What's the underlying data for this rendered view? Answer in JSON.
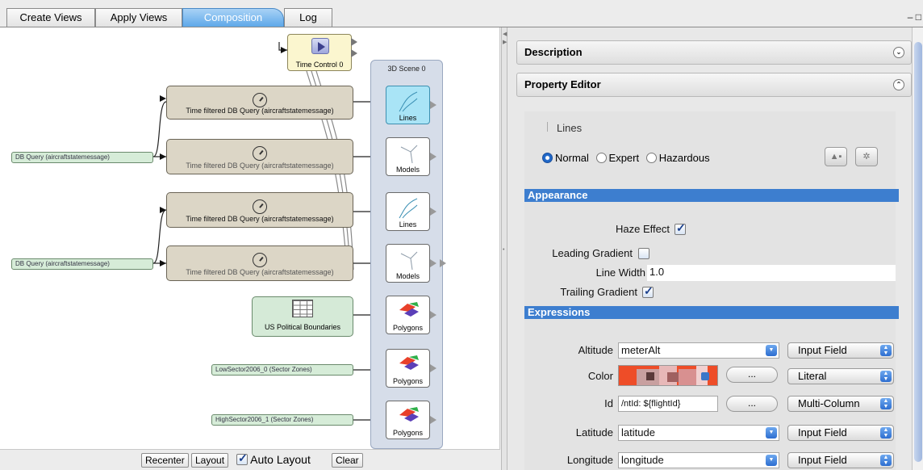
{
  "tabs": [
    {
      "label": "Create Views",
      "active": false
    },
    {
      "label": "Apply Views",
      "active": false
    },
    {
      "label": "Composition",
      "active": true
    },
    {
      "label": "Log",
      "active": false
    }
  ],
  "window_control": "– □",
  "graph": {
    "scene_title": "3D Scene 0",
    "time_control_label": "Time Control 0",
    "query_nodes": [
      "Time filtered DB Query (aircraftstatemessage)",
      "Time filtered DB Query (aircraftstatemessage)",
      "Time filtered DB Query (aircraftstatemessage)",
      "Time filtered DB Query (aircraftstatemessage)"
    ],
    "source_nodes": [
      "DB Query (aircraftstatemessage)",
      "DB Query (aircraftstatemessage)",
      "LowSector2006_0 (Sector Zones)",
      "HighSector2006_1 (Sector Zones)"
    ],
    "polygon_source_label": "US Political Boundaries",
    "layers": [
      "Lines",
      "Models",
      "Lines",
      "Models",
      "Polygons",
      "Polygons",
      "Polygons"
    ]
  },
  "bottom_bar": {
    "recenter": "Recenter",
    "layout": "Layout",
    "auto_layout": "Auto Layout",
    "auto_layout_checked": true,
    "clear": "Clear"
  },
  "panel": {
    "description_title": "Description",
    "property_editor_title": "Property Editor",
    "layer_name": "Lines",
    "modes": [
      "Normal",
      "Expert",
      "Hazardous"
    ],
    "selected_mode": "Normal",
    "appearance_title": "Appearance",
    "haze_effect": {
      "label": "Haze Effect",
      "checked": true
    },
    "leading_gradient": {
      "label": "Leading Gradient",
      "checked": false
    },
    "line_width": {
      "label": "Line Width",
      "value": "1.0"
    },
    "trailing_gradient": {
      "label": "Trailing Gradient",
      "checked": true
    },
    "expressions_title": "Expressions",
    "altitude": {
      "label": "Altitude",
      "value": "meterAlt",
      "mode": "Input Field"
    },
    "color": {
      "label": "Color",
      "mode": "Literal",
      "ellipsis": "..."
    },
    "id": {
      "label": "Id",
      "value": "/ntId: ${flightId}",
      "mode": "Multi-Column",
      "ellipsis": "..."
    },
    "latitude": {
      "label": "Latitude",
      "value": "latitude",
      "mode": "Input Field"
    },
    "longitude": {
      "label": "Longitude",
      "value": "longitude",
      "mode": "Input Field"
    }
  },
  "colors": {
    "accent": "#3d7ecf",
    "selected_layer": "#a9e4f6",
    "swatch": "#ee4d28"
  }
}
